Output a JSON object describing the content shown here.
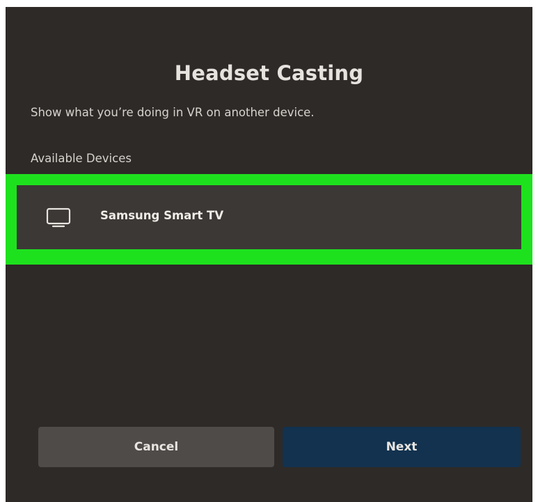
{
  "dialog": {
    "title": "Headset Casting",
    "subtitle": "Show what you’re doing in VR on another device.",
    "section_label": "Available Devices"
  },
  "devices": [
    {
      "label": "Samsung Smart TV",
      "icon": "tv-icon",
      "selected": true
    }
  ],
  "buttons": {
    "cancel_label": "Cancel",
    "next_label": "Next"
  },
  "colors": {
    "background": "#2e2a28",
    "highlight": "#1ee11e",
    "device_row": "#3c3835",
    "cancel_button": "#4f4b48",
    "next_button": "#12324f"
  }
}
